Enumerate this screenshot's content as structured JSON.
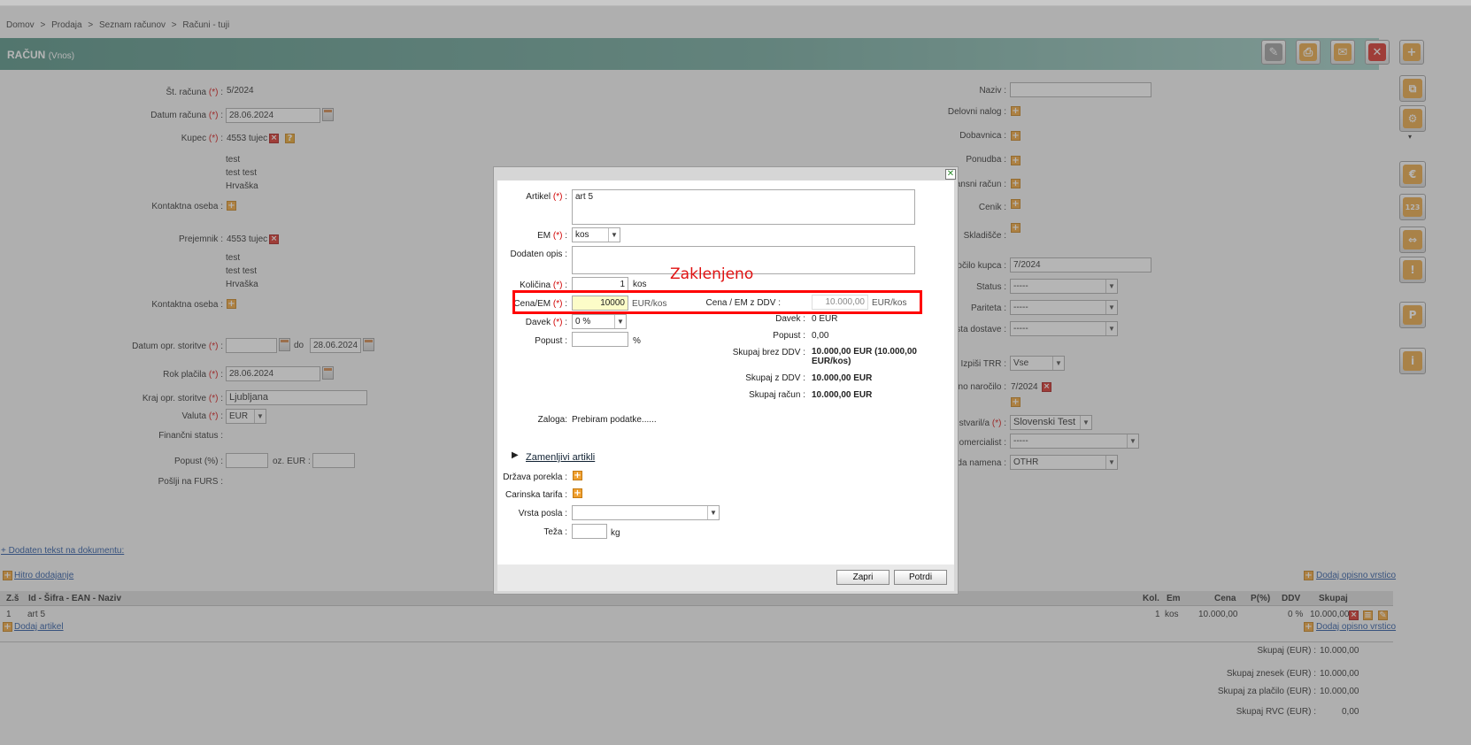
{
  "breadcrumb": [
    "Domov",
    ">",
    "Prodaja",
    ">",
    "Seznam računov",
    ">",
    "Računi - tuji"
  ],
  "header": {
    "title": "RAČUN",
    "subtitle": "(Vnos)"
  },
  "toolbar": {
    "edit": "✎",
    "print": "⎙",
    "mail": "✉",
    "cancel": "✕",
    "add": "+"
  },
  "side": {
    "copy": "⧉",
    "settings": "⚙",
    "euro": "€",
    "num": "123",
    "split": "⇔",
    "warn": "!",
    "p": "P",
    "info": "i",
    "more": "▾"
  },
  "left": {
    "st_racuna_label": "Št. računa",
    "st_racuna": "5/2024",
    "datum_label": "Datum računa",
    "datum": "28.06.2024",
    "kupec_label": "Kupec",
    "kupec": "4553 tujec",
    "kupec_addr": [
      "test",
      "test test",
      "Hrvaška"
    ],
    "kontakt_label": "Kontaktna oseba :",
    "prejemnik_label": "Prejemnik",
    "prejemnik": "4553 tujec",
    "prejemnik_addr": [
      "test",
      "test test",
      "Hrvaška"
    ],
    "kontakt2_label": "Kontaktna oseba :",
    "datum_opr_label": "Datum opr. storitve",
    "datum_opr_do": "do",
    "datum_opr_to": "28.06.2024",
    "rok_label": "Rok plačila",
    "rok": "28.06.2024",
    "kraj_label": "Kraj opr. storitve",
    "kraj": "Ljubljana",
    "valuta_label": "Valuta",
    "valuta": "EUR",
    "fin_label": "Finančni status :",
    "popust_label": "Popust (%) :",
    "popust_oz": "oz. EUR :",
    "furs_label": "Pošlji na FURS :"
  },
  "right": {
    "naziv": "Naziv :",
    "delovni": "Delovni nalog :",
    "dobavnica": "Dobavnica :",
    "ponudba": "Ponudba :",
    "avansni": "ansni račun :",
    "cenik": "Cenik :",
    "skladisce": "Skladišče :",
    "narocilo_label": "očilo kupca :",
    "narocilo": "7/2024",
    "status": "Status :",
    "status_val": "-----",
    "pariteta": "Pariteta :",
    "pariteta_val": "-----",
    "dostava": "sta dostave :",
    "dostava_val": "-----",
    "trr": "Izpiši TRR :",
    "trr_val": "Vse",
    "ino": "no naročilo :",
    "ino_val": "7/2024",
    "ustvaril": "ustvaril/a",
    "ustvaril_val": "Slovenski Test",
    "komercialist": "omercialist :",
    "komercialist_val": "-----",
    "namena": "da namena :",
    "namena_val": "OTHR"
  },
  "links": {
    "dodaten_tekst": "+ Dodaten tekst na dokumentu:",
    "hitro": "Hitro dodajanje",
    "opisno": "Dodaj opisno vrstico",
    "dodaj_artikel": "Dodaj artikel",
    "opisno2": "Dodaj opisno vrstico"
  },
  "table": {
    "headers": {
      "zs": "Z.š",
      "id": "Id - Šifra - EAN - Naziv",
      "kol": "Kol.",
      "em": "Em",
      "cena": "Cena",
      "p": "P(%)",
      "ddv": "DDV",
      "skupaj": "Skupaj"
    },
    "row": {
      "zs": "1",
      "id": "art 5",
      "kol": "1",
      "em": "kos",
      "cena": "10.000,00",
      "ddv": "0 %",
      "skupaj": "10.000,00"
    }
  },
  "totals": [
    {
      "label": "Skupaj (EUR) :",
      "value": "10.000,00"
    },
    {
      "label": "Skupaj znesek (EUR) :",
      "value": "10.000,00"
    },
    {
      "label": "Skupaj za plačilo (EUR) :",
      "value": "10.000,00"
    },
    {
      "label": "Skupaj RVC (EUR) :",
      "value": "0,00"
    }
  ],
  "modal": {
    "artikel_label": "Artikel",
    "artikel": "art 5",
    "em_label": "EM",
    "em": "kos",
    "opis_label": "Dodaten opis :",
    "kolicina_label": "Količina",
    "kolicina": "1",
    "kolicina_unit": "kos",
    "cena_label": "Cena/EM",
    "cena": "10000",
    "cena_unit": "EUR/kos",
    "cena_ddv_label": "Cena / EM z DDV :",
    "cena_ddv": "10.000,00",
    "cena_ddv_unit": "EUR/kos",
    "davek_label": "Davek",
    "davek": "0 %",
    "popust_label": "Popust :",
    "popust_unit": "%",
    "r_davek_label": "Davek :",
    "r_davek": "0 EUR",
    "r_popust_label": "Popust :",
    "r_popust": "0,00",
    "r_brez_label": "Skupaj brez DDV :",
    "r_brez": "10.000,00 EUR (10.000,00",
    "r_brez2": "EUR/kos)",
    "r_zddv_label": "Skupaj z DDV :",
    "r_zddv": "10.000,00 EUR",
    "r_racun_label": "Skupaj račun :",
    "r_racun": "10.000,00 EUR",
    "zaloga_label": "Zaloga:",
    "zaloga": "Prebiram podatke......",
    "zamenljivi": "Zamenljivi artikli",
    "drzava_label": "Država porekla :",
    "carinska_label": "Carinska tarifa :",
    "vrsta_label": "Vrsta posla :",
    "teza_label": "Teža :",
    "teza_unit": "kg",
    "zapri": "Zapri",
    "potrdi": "Potrdi",
    "close": "✕",
    "req": "(*)",
    "colon": ":"
  },
  "annotation": "Zaklenjeno"
}
